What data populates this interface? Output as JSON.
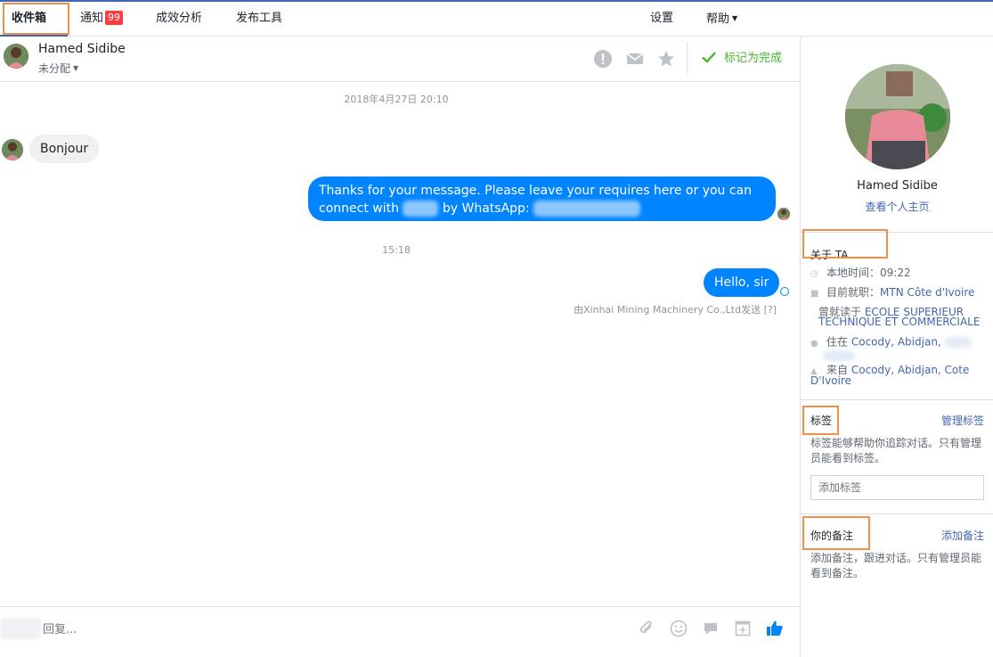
{
  "nav": {
    "tabs": [
      {
        "label": "收件箱",
        "active": true
      },
      {
        "label": "通知",
        "badge": "99"
      },
      {
        "label": "成效分析"
      },
      {
        "label": "发布工具"
      }
    ],
    "settings": "设置",
    "help": "帮助"
  },
  "conversation": {
    "contact_name": "Hamed Sidibe",
    "assignment": "未分配",
    "mark_done": "标记为完成",
    "icons": [
      "alert-icon",
      "mail-icon",
      "star-icon",
      "checkmark-icon"
    ]
  },
  "messages": {
    "date_stamp": "2018年4月27日 20:10",
    "in_1": "Bonjour",
    "out_1_part1": "Thanks for your message. Please leave your requires here or you can connect with",
    "out_1_part2": "by WhatsApp:",
    "time_stamp": "15:18",
    "out_2": "Hello, sir",
    "sent_by": "由Xinhai Mining Machinery Co.,Ltd发送",
    "sent_by_help": "[?]"
  },
  "composer": {
    "placeholder": "回复...",
    "icons": [
      "attachment-icon",
      "emoji-icon",
      "sticker-icon",
      "saved-reply-icon",
      "like-icon"
    ]
  },
  "profile": {
    "name": "Hamed Sidibe",
    "view_profile": "查看个人主页",
    "about_title": "关于 TA",
    "local_time_label": "本地时间：",
    "local_time": "09:22",
    "work_label": "目前就职：",
    "work": "MTN Côte d'Ivoire",
    "study_label": "曾就读于",
    "study": "ECOLE SUPERIEUR TECHNIQUE ET COMMERCIALE",
    "lives_label": "住在",
    "lives": "Cocody, Abidjan,",
    "from_label": "来自",
    "from": "Cocody, Abidjan, Cote D'Ivoire",
    "tags_title": "标签",
    "tags_action": "管理标签",
    "tags_desc": "标签能够帮助你追踪对话。只有管理员能看到标签。",
    "tags_placeholder": "添加标签",
    "notes_title": "你的备注",
    "notes_action": "添加备注",
    "notes_desc": "添加备注，跟进对话。只有管理员能看到备注。"
  },
  "colors": {
    "accent": "#4267b2",
    "bubble_out": "#0084ff",
    "done_green": "#42b72a",
    "badge_red": "#fa3e3e",
    "highlight": "#f0914a"
  }
}
